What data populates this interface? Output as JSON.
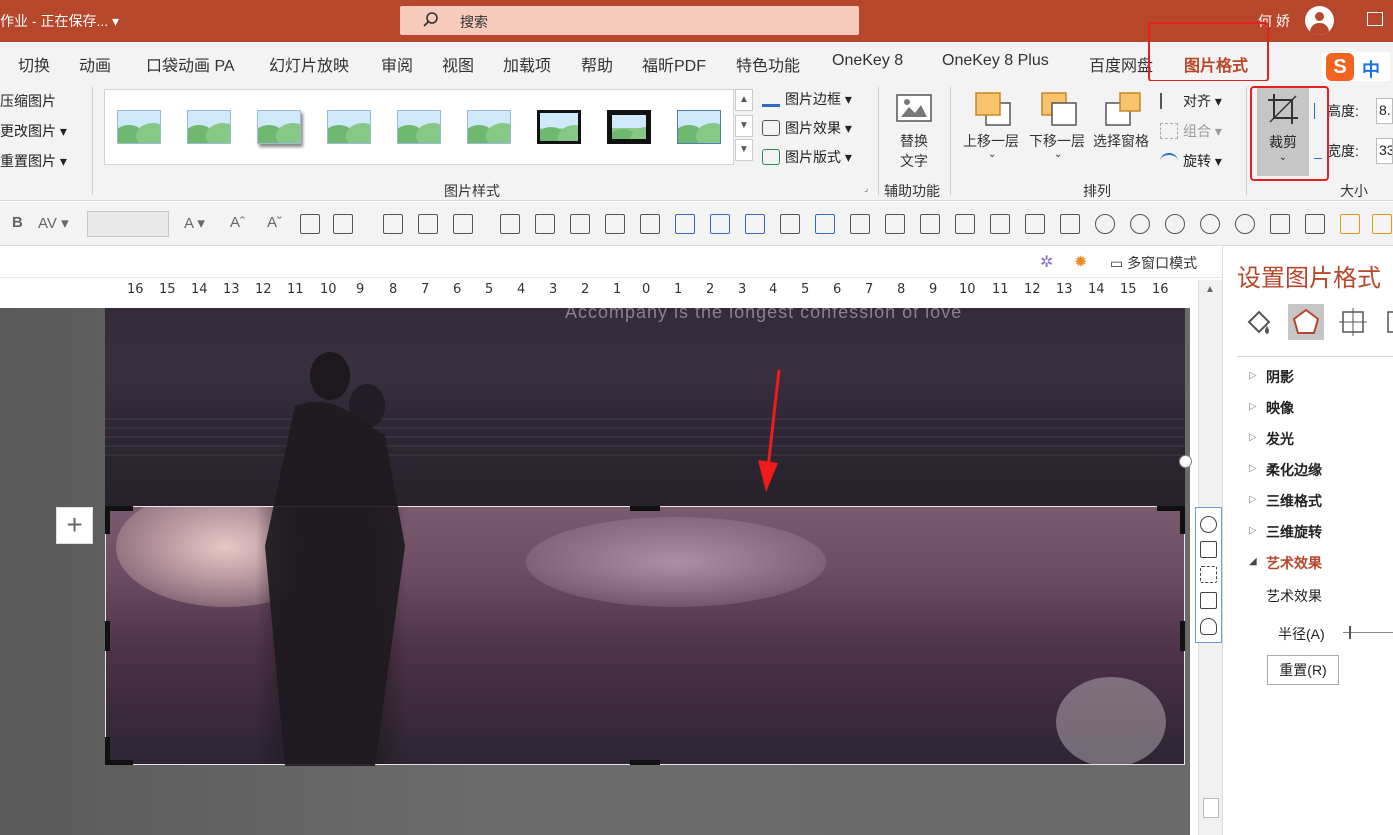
{
  "titlebar": {
    "doc_title": "作业  -  正在保存...  ▾",
    "search_label": "搜索",
    "user_name": "何 娇"
  },
  "tabs": [
    "切换",
    "动画",
    "口袋动画 PA",
    "幻灯片放映",
    "审阅",
    "视图",
    "加载项",
    "帮助",
    "福昕PDF",
    "特色功能",
    "OneKey 8",
    "OneKey 8 Plus",
    "百度网盘",
    "图片格式"
  ],
  "ime": {
    "s": "S",
    "zh": "中"
  },
  "ribbon": {
    "adjust": [
      "压缩图片",
      "更改图片 ▾",
      "重置图片  ▾"
    ],
    "pic_border": "图片边框 ▾",
    "pic_effect": "图片效果 ▾",
    "pic_layout": "图片版式 ▾",
    "group_styles": "图片样式",
    "alt_text_1": "替换",
    "alt_text_2": "文字",
    "group_access": "辅助功能",
    "bring_forward": "上移一层",
    "send_backward": "下移一层",
    "selection_pane": "选择窗格",
    "align": "对齐 ▾",
    "group_items": "组合 ▾",
    "rotate": "旋转 ▾",
    "group_arrange": "排列",
    "crop": "裁剪",
    "crop_chevron": "⌄",
    "height_label": "高度:",
    "height_value": "8.",
    "width_label": "宽度:",
    "width_value": "33",
    "group_size": "大小"
  },
  "docbar": {
    "multi_window": "多窗口模式"
  },
  "ruler": [
    "16",
    "15",
    "14",
    "13",
    "12",
    "11",
    "10",
    "9",
    "8",
    "7",
    "6",
    "5",
    "4",
    "3",
    "2",
    "1",
    "0",
    "1",
    "2",
    "3",
    "4",
    "5",
    "6",
    "7",
    "8",
    "9",
    "10",
    "11",
    "12",
    "13",
    "14",
    "15",
    "16"
  ],
  "slide": {
    "caption": "Accompany is  the longest  confession of love",
    "plus": "+"
  },
  "pane": {
    "title": "设置图片格式",
    "sections": [
      "阴影",
      "映像",
      "发光",
      "柔化边缘",
      "三维格式",
      "三维旋转",
      "艺术效果"
    ],
    "art_effect_sub": "艺术效果",
    "radius_label": "半径(A)",
    "reset": "重置(R)"
  },
  "colors": {
    "accent": "#b7472a",
    "highlight": "#e52020"
  }
}
